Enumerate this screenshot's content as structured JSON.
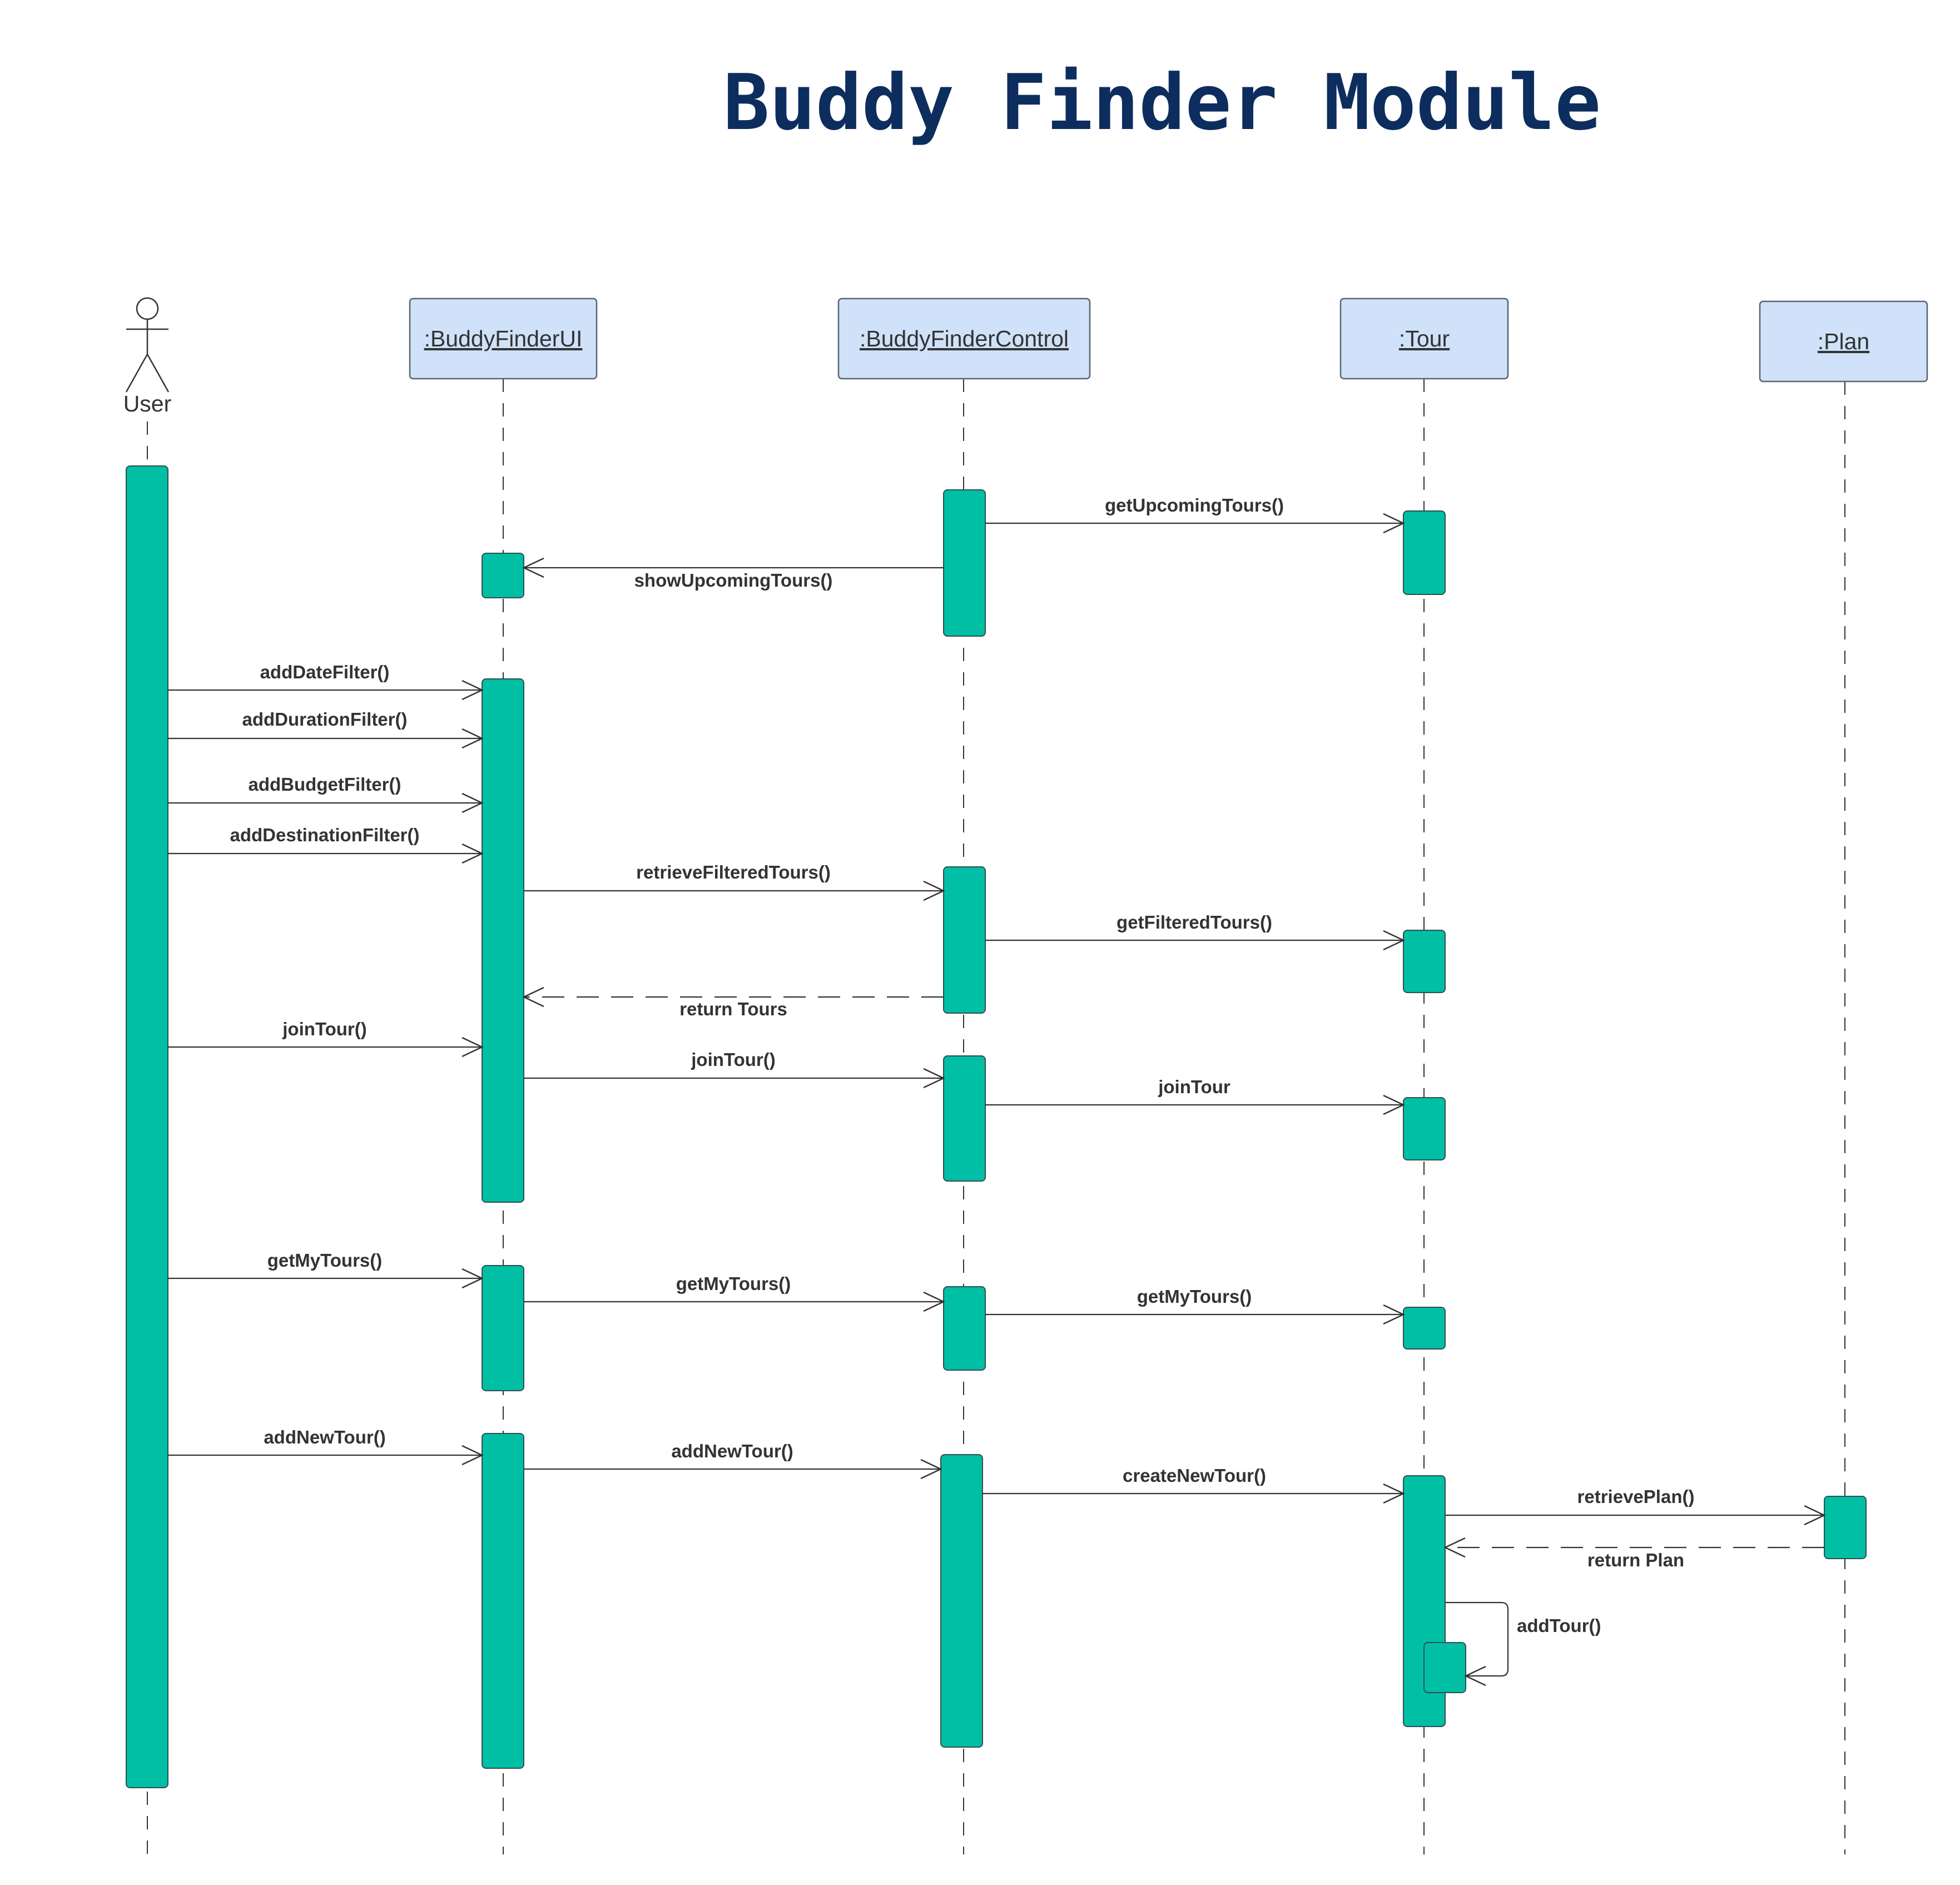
{
  "title": "Buddy Finder Module",
  "colors": {
    "title": "#0d2d5e",
    "header_fill": "#cfe2f9",
    "header_stroke": "#5a6473",
    "activation_fill": "#00bfa5",
    "activation_stroke": "#2f4f4f",
    "line": "#333333",
    "text": "#333333"
  },
  "participants": [
    {
      "id": "user",
      "kind": "actor",
      "label": "User"
    },
    {
      "id": "ui",
      "kind": "object",
      "label": ":BuddyFinderUI"
    },
    {
      "id": "control",
      "kind": "object",
      "label": ":BuddyFinderControl"
    },
    {
      "id": "tour",
      "kind": "object",
      "label": ":Tour"
    },
    {
      "id": "plan",
      "kind": "object",
      "label": ":Plan"
    }
  ],
  "messages": [
    {
      "from": "control",
      "to": "tour",
      "label": "getUpcomingTours()",
      "style": "sync"
    },
    {
      "from": "control",
      "to": "ui",
      "label": "showUpcomingTours()",
      "style": "sync"
    },
    {
      "from": "user",
      "to": "ui",
      "label": "addDateFilter()",
      "style": "sync"
    },
    {
      "from": "user",
      "to": "ui",
      "label": "addDurationFilter()",
      "style": "sync"
    },
    {
      "from": "user",
      "to": "ui",
      "label": "addBudgetFilter()",
      "style": "sync"
    },
    {
      "from": "user",
      "to": "ui",
      "label": "addDestinationFilter()",
      "style": "sync"
    },
    {
      "from": "ui",
      "to": "control",
      "label": "retrieveFilteredTours()",
      "style": "sync"
    },
    {
      "from": "control",
      "to": "tour",
      "label": "getFilteredTours()",
      "style": "sync"
    },
    {
      "from": "control",
      "to": "ui",
      "label": "return Tours",
      "style": "return"
    },
    {
      "from": "user",
      "to": "ui",
      "label": "joinTour()",
      "style": "sync"
    },
    {
      "from": "ui",
      "to": "control",
      "label": "joinTour()",
      "style": "sync"
    },
    {
      "from": "control",
      "to": "tour",
      "label": "joinTour",
      "style": "sync"
    },
    {
      "from": "user",
      "to": "ui",
      "label": "getMyTours()",
      "style": "sync"
    },
    {
      "from": "ui",
      "to": "control",
      "label": "getMyTours()",
      "style": "sync"
    },
    {
      "from": "control",
      "to": "tour",
      "label": "getMyTours()",
      "style": "sync"
    },
    {
      "from": "user",
      "to": "ui",
      "label": "addNewTour()",
      "style": "sync"
    },
    {
      "from": "ui",
      "to": "control",
      "label": "addNewTour()",
      "style": "sync"
    },
    {
      "from": "control",
      "to": "tour",
      "label": "createNewTour()",
      "style": "sync"
    },
    {
      "from": "tour",
      "to": "plan",
      "label": "retrievePlan()",
      "style": "sync"
    },
    {
      "from": "plan",
      "to": "tour",
      "label": "return Plan",
      "style": "return"
    },
    {
      "from": "tour",
      "to": "tour",
      "label": "addTour()",
      "style": "self"
    }
  ]
}
